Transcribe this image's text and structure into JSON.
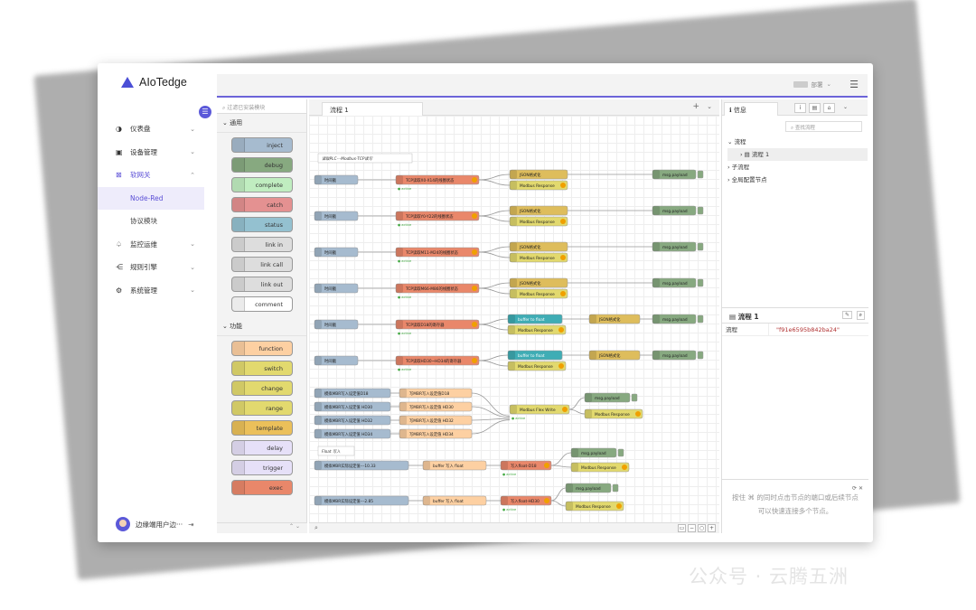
{
  "brand": {
    "name": "AIoTedge"
  },
  "nav": {
    "items": [
      {
        "label": "仪表盘"
      },
      {
        "label": "设备管理"
      },
      {
        "label": "软网关"
      },
      {
        "label": "Node-Red"
      },
      {
        "label": "协议模块"
      },
      {
        "label": "监控运维"
      },
      {
        "label": "规则引擎"
      },
      {
        "label": "系统管理"
      }
    ],
    "user": "边缘端用户边···"
  },
  "header": {
    "deploy_label": "部署"
  },
  "palette": {
    "filter_placeholder": "过滤已安装模块",
    "category_common": "通用",
    "category_function": "功能",
    "common_nodes": [
      "inject",
      "debug",
      "complete",
      "catch",
      "status",
      "link in",
      "link call",
      "link out",
      "comment"
    ],
    "function_nodes": [
      "function",
      "switch",
      "change",
      "range",
      "template",
      "delay",
      "trigger",
      "exec"
    ]
  },
  "workspace": {
    "tab_label": "流程 1"
  },
  "sidebar": {
    "tab_label": "信息",
    "search_placeholder": "查找流程",
    "tree": [
      "流程",
      "流程 1",
      "子流程",
      "全局配置节点"
    ],
    "flow_title": "流程 1",
    "prop_key": "流程",
    "prop_value": "\"f91e6595b842ba24\"",
    "tip": "按住 ⌘ 的同时点击节点的端口或后续节点可以快速连接多个节点。"
  },
  "flow": {
    "comment1": "读取PLC---Modbus-TCP读写",
    "comment2": "Float 写入",
    "inject": "时间戳",
    "read_nodes": [
      "TCP读取X0-X14的线圈状态",
      "TCP读取Y0-Y22的线圈状态",
      "TCP读取M11-M24的线圈状态",
      "TCP读取M66-M86的线圈状态",
      "TCP读取D18的寄存器",
      "TCP读取HD30~HD34的寄存器"
    ],
    "json": "JSON格式化",
    "modbus_response": "Modbus Response",
    "buffer": "buffer to float",
    "debug": "msg.payload",
    "active": "active",
    "set_nodes": [
      "模拟MBR写入设定值D18",
      "模拟MBR写入设定值 HD30",
      "模拟MBR写入设定值 HD32",
      "模拟MBR写入设定值 HD34"
    ],
    "convert_nodes": [
      "写MBR写入设定值D18",
      "写MBR写入设定值 HD30",
      "写MBR写入设定值 HD32",
      "写MBR写入设定值 HD34"
    ],
    "flex_write": "Modbus Flex Write",
    "float_inject1": "模拟MBR实际设定值---10.33",
    "float_inject2": "模拟MBR实际设定值---2.85",
    "buffer_write": "buffer 写入 float",
    "write_d18": "写入float-D18",
    "write_hd30": "写入float-HD30"
  },
  "watermark": "公众号 · 云腾五洲",
  "colors": {
    "accent": "#5b59d9",
    "inject": "#a6bbcf",
    "modbus": "#e2d96e",
    "tcp": "#e9876a",
    "json": "#debd5c",
    "debug": "#87a980",
    "buffer": "#3fadb5",
    "function": "#fdd0a2"
  }
}
